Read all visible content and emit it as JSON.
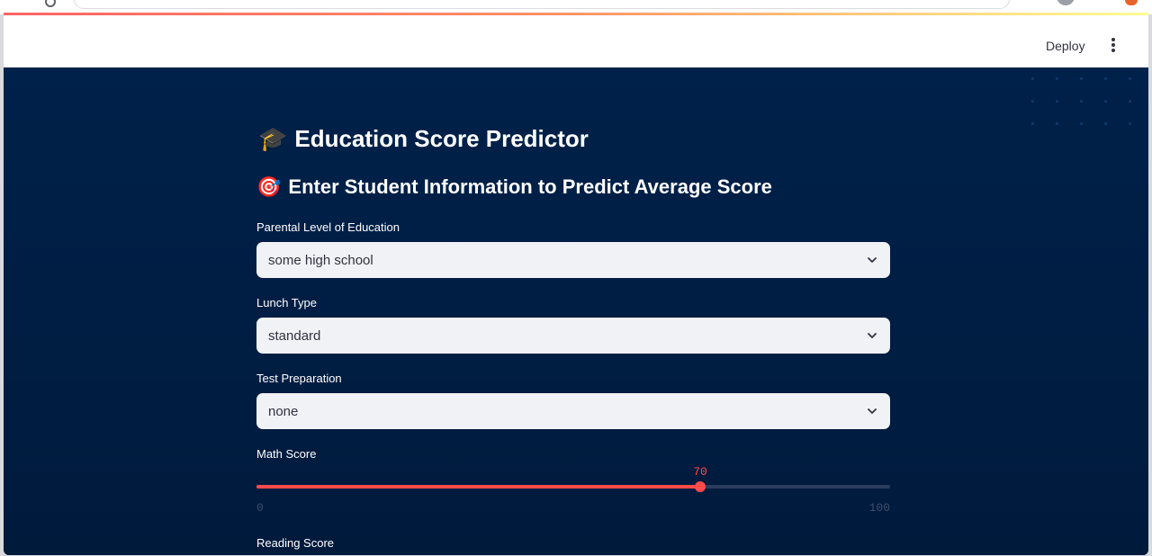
{
  "header": {
    "deploy_label": "Deploy",
    "menu_icon": "vertical-dots-icon"
  },
  "main": {
    "title_emoji": "🎓",
    "title": "Education Score Predictor",
    "subtitle_emoji": "🎯",
    "subtitle": "Enter Student Information to Predict Average Score",
    "fields": [
      {
        "label": "Parental Level of Education",
        "value": "some high school"
      },
      {
        "label": "Lunch Type",
        "value": "standard"
      },
      {
        "label": "Test Preparation",
        "value": "none"
      }
    ],
    "math_slider": {
      "label": "Math Score",
      "value": 70,
      "min": 0,
      "max": 100,
      "value_text": "70",
      "min_text": "0",
      "max_text": "100"
    },
    "reading_label": "Reading Score"
  },
  "colors": {
    "accent": "#ff4b4b",
    "background": "#001f44",
    "header": "#ffffff"
  }
}
